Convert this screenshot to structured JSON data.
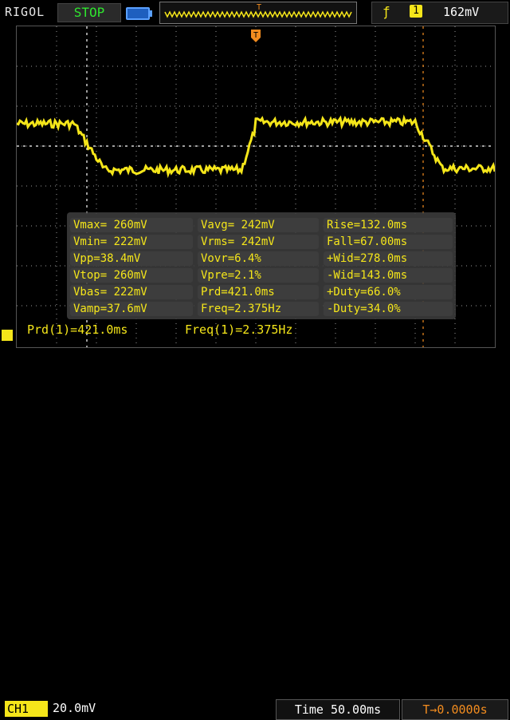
{
  "header": {
    "brand": "RIGOL",
    "run_state": "STOP",
    "trigger_level": "162mV",
    "trigger_channel": "1",
    "trigger_marker": "T"
  },
  "channel": {
    "label": "CH1",
    "scale": "20.0mV"
  },
  "timebase": {
    "label": "Time",
    "scale": "50.00ms",
    "offset": "0.0000s"
  },
  "measurements": [
    [
      "Vmax= 260mV",
      "Vavg= 242mV",
      "Rise=132.0ms"
    ],
    [
      "Vmin= 222mV",
      "Vrms= 242mV",
      "Fall=67.00ms"
    ],
    [
      "Vpp=38.4mV",
      "Vovr=6.4%",
      "+Wid=278.0ms"
    ],
    [
      "Vtop= 260mV",
      "Vpre=2.1%",
      "-Wid=143.0ms"
    ],
    [
      "Vbas= 222mV",
      "Prd=421.0ms",
      "+Duty=66.0%"
    ],
    [
      "Vamp=37.6mV",
      "Freq=2.375Hz",
      "-Duty=34.0%"
    ]
  ],
  "footer": {
    "period": "Prd(1)=421.0ms",
    "frequency": "Freq(1)=2.375Hz"
  },
  "colors": {
    "trace": "#f5e61a",
    "grid": "#9a9a9a",
    "accent": "#f28c1f"
  }
}
